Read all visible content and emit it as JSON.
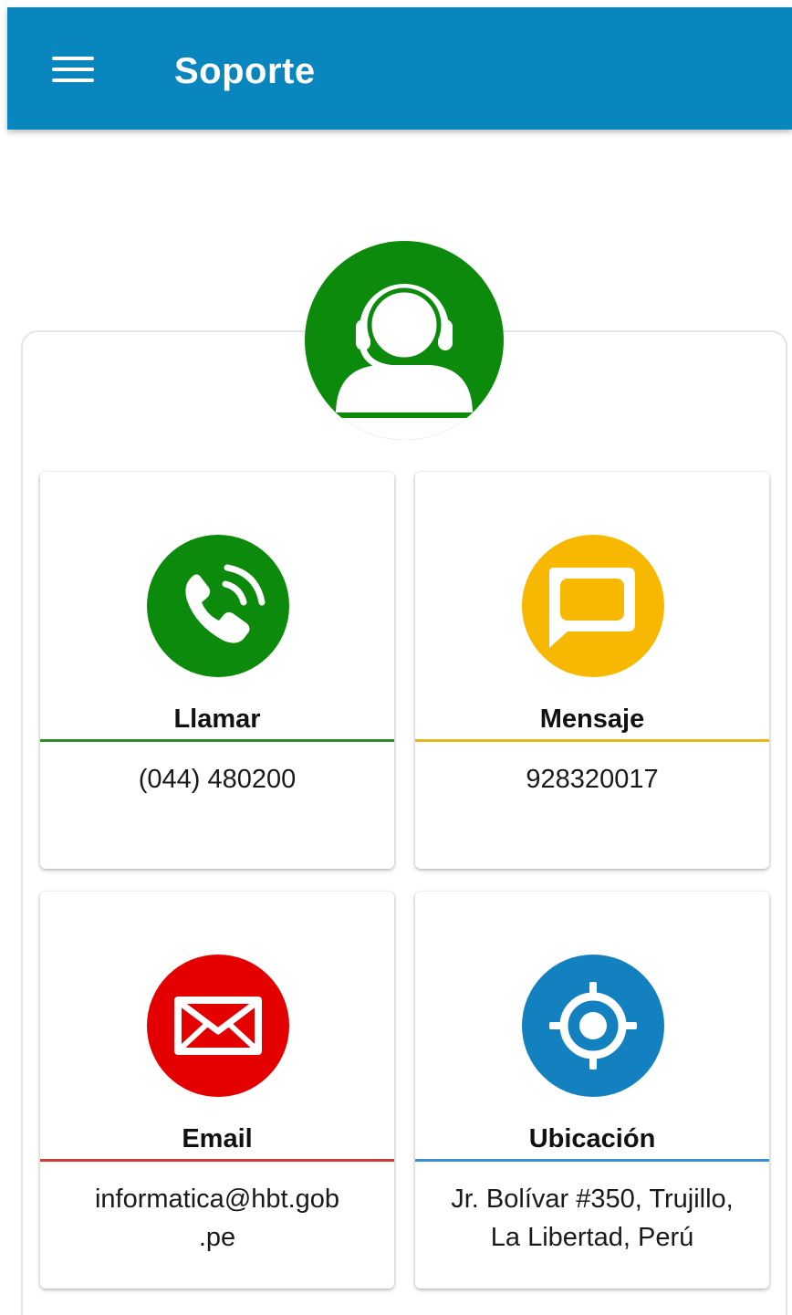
{
  "app_bar": {
    "title": "Soporte",
    "menu_icon": "menu-icon",
    "color": "#0A86BF"
  },
  "header_avatar": {
    "icon": "support-agent-headset-icon",
    "color": "#0C8A0C"
  },
  "cards": [
    {
      "id": "llamar",
      "label": "Llamar",
      "value": "(044) 480200",
      "icon": "phone-call-icon",
      "color": "#0C8A0C"
    },
    {
      "id": "mensaje",
      "label": "Mensaje",
      "value": "928320017",
      "icon": "chat-bubble-icon",
      "color": "#F6B800"
    },
    {
      "id": "email",
      "label": "Email",
      "value_lines": [
        "informatica@hbt.gob",
        ".pe"
      ],
      "icon": "envelope-icon",
      "color": "#E50000"
    },
    {
      "id": "ubicacion",
      "label": "Ubicación",
      "value_lines": [
        "Jr. Bolívar #350, Trujillo,",
        "La Libertad, Perú"
      ],
      "icon": "location-target-icon",
      "color": "#1380C0"
    }
  ]
}
